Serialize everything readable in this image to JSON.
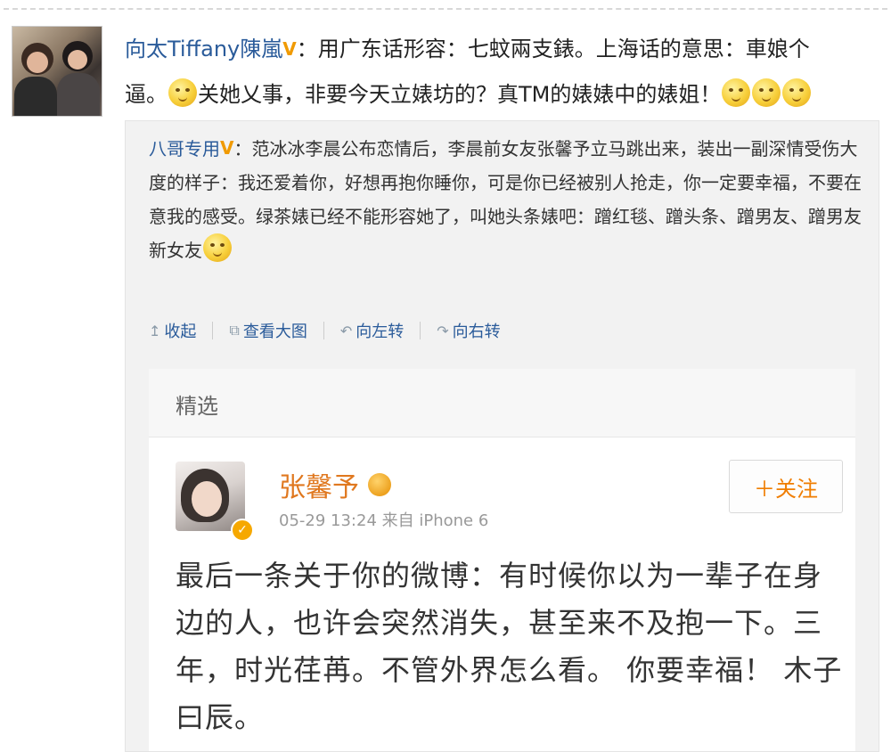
{
  "top_post": {
    "username": "向太Tiffany陳嵐",
    "verified_mark": "V",
    "text_line1": "：用广东话形容：七蚊兩支錶。上海话的意思：車娘个",
    "text_line2_a": "逼。",
    "text_line2_b": "关她乂事，非要今天立婊坊的？真TM的婊婊中的婊姐！",
    "emoticons": [
      "sleepy-emoji",
      "cry-emoji",
      "shock-emoji",
      "sad-emoji"
    ]
  },
  "repost": {
    "username": "八哥专用",
    "verified_mark": "V",
    "text": "：范冰冰李晨公布恋情后，李晨前女友张馨予立马跳出来，装出一副深情受伤大度的样子：我还爱着你，好想再抱你睡你，可是你已经被别人抢走，你一定要幸福，不要在意我的感受。绿茶婊已经不能形容她了，叫她头条婊吧：蹭红毯、蹭头条、蹭男友、蹭男友新女友",
    "emoticon": "smirk-emoji",
    "actions": [
      {
        "icon": "↥",
        "label": "收起"
      },
      {
        "icon": "⧉",
        "label": "查看大图"
      },
      {
        "icon": "↶",
        "label": "向左转"
      },
      {
        "icon": "↷",
        "label": "向右转"
      }
    ]
  },
  "featured": {
    "header": "精选",
    "username": "张馨予",
    "verified_mark": "✓",
    "timestamp": "05-29 13:24",
    "source": "来自 iPhone 6",
    "follow_label": "＋关注",
    "text": "最后一条关于你的微博：有时候你以为一辈子在身边的人，也许会突然消失，甚至来不及抱一下。三年，时光荏苒。不管外界怎么看。 你要幸福！ 木子曰辰。"
  }
}
